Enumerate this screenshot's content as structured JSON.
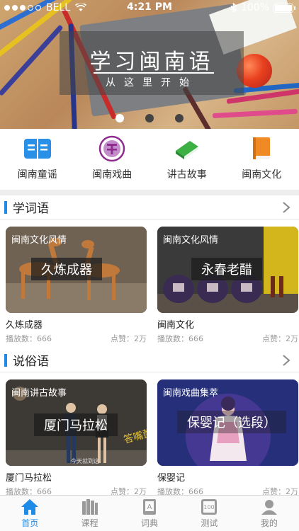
{
  "status_bar": {
    "carrier": "BELL",
    "time": "4:21 PM",
    "battery": "100%"
  },
  "banner": {
    "title": "学习闽南语",
    "subtitle": "从这里开始",
    "page_count": 3,
    "active_page": 1
  },
  "categories": [
    {
      "label": "闽南童谣",
      "icon": "open-book-icon",
      "color": "#2a8fe6"
    },
    {
      "label": "闽南戏曲",
      "icon": "opera-badge-icon",
      "color": "#8e2c8f"
    },
    {
      "label": "讲古故事",
      "icon": "green-book-icon",
      "color": "#3cb043"
    },
    {
      "label": "闽南文化",
      "icon": "orange-book-icon",
      "color": "#f08a24"
    }
  ],
  "sections": [
    {
      "title": "学词语",
      "cards": [
        {
          "tag": "闽南文化风情",
          "caption": "久炼成器",
          "name": "久炼成器",
          "plays": "播放数：666",
          "likes": "点赞：2万"
        },
        {
          "tag": "闽南文化风情",
          "caption": "永春老醋",
          "name": "闽南文化",
          "plays": "播放数：666",
          "likes": "点赞：2万"
        }
      ]
    },
    {
      "title": "说俗语",
      "cards": [
        {
          "tag": "闽南讲古故事",
          "caption": "厦门马拉松",
          "name": "厦门马拉松",
          "plays": "播放数：666",
          "likes": "点赞：2万"
        },
        {
          "tag": "闽南戏曲集萃",
          "caption": "保婴记（选段）",
          "name": "保婴记",
          "plays": "播放数：666",
          "likes": "点赞：2万"
        }
      ]
    }
  ],
  "tabs": [
    {
      "label": "首页",
      "icon": "home-icon",
      "active": true
    },
    {
      "label": "课程",
      "icon": "books-icon",
      "active": false
    },
    {
      "label": "词典",
      "icon": "dictionary-icon",
      "active": false
    },
    {
      "label": "测试",
      "icon": "test-icon",
      "active": false
    },
    {
      "label": "我的",
      "icon": "user-icon",
      "active": false
    }
  ],
  "colors": {
    "accent": "#1e8ce6"
  }
}
